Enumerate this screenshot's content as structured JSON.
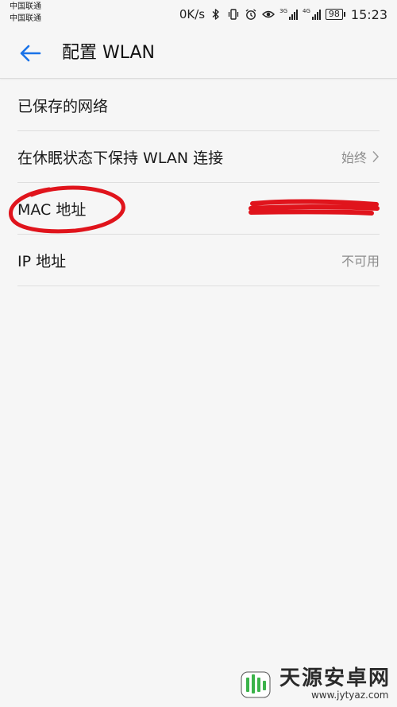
{
  "status_bar": {
    "carrier_1": "中国联通",
    "carrier_2": "中国联通",
    "net_speed": "0K/s",
    "sig1_tag": "3G",
    "sig2_tag": "4G",
    "battery": "98",
    "time": "15:23"
  },
  "header": {
    "title": "配置 WLAN",
    "back_icon": "arrow-left-icon"
  },
  "settings": {
    "items": [
      {
        "label": "已保存的网络",
        "value": ""
      },
      {
        "label": "在休眠状态下保持 WLAN 连接",
        "value": "始终"
      },
      {
        "label": "MAC 地址",
        "value": ""
      },
      {
        "label": "IP 地址",
        "value": "不可用"
      }
    ]
  },
  "annotation": {
    "circle_color": "#e0141c",
    "redaction_color": "#e0141c"
  },
  "watermark": {
    "text": "天源安卓网",
    "url": "www.jytyaz.com"
  },
  "colors": {
    "accent": "#1a73e8",
    "background": "#f6f6f6",
    "divider": "#dedede",
    "secondary_text": "#8c8c8c"
  }
}
